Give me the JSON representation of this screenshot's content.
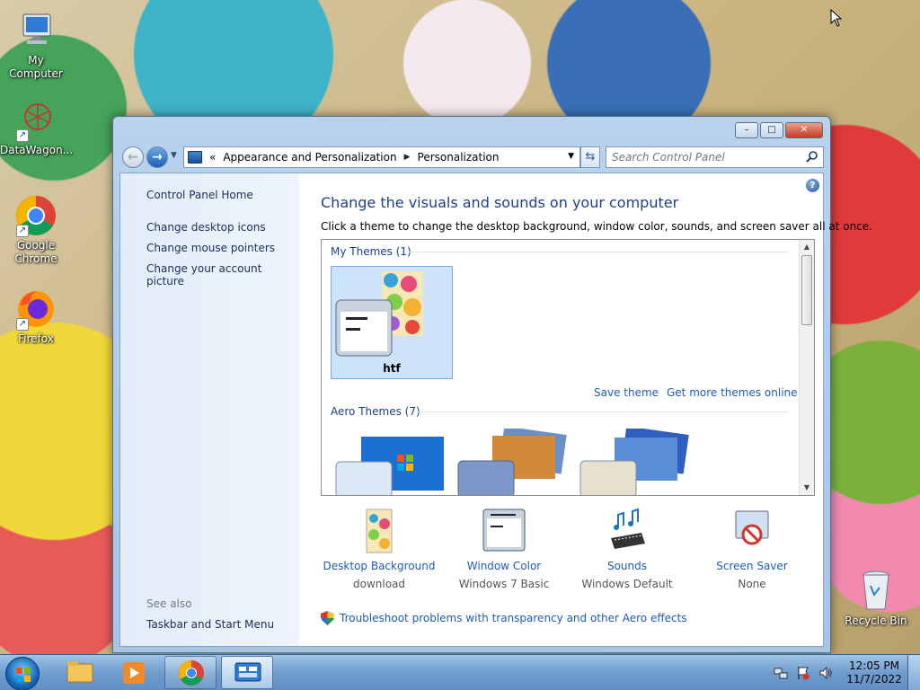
{
  "desktop": {
    "icons": [
      {
        "label": "My Computer"
      },
      {
        "label": "DataWagon..."
      },
      {
        "label": "Google Chrome"
      },
      {
        "label": "Firefox"
      },
      {
        "label": "Recycle Bin"
      }
    ]
  },
  "window": {
    "controls": {
      "minimize": "–",
      "maximize": "□",
      "close": "✕"
    },
    "address": {
      "overflow": "«",
      "segments": [
        "Appearance and Personalization",
        "Personalization"
      ]
    },
    "search": {
      "placeholder": "Search Control Panel"
    }
  },
  "left_pane": {
    "home": "Control Panel Home",
    "links": [
      "Change desktop icons",
      "Change mouse pointers",
      "Change your account picture"
    ],
    "see_also_label": "See also",
    "see_also_links": [
      "Taskbar and Start Menu"
    ]
  },
  "main": {
    "help": "?",
    "title": "Change the visuals and sounds on your computer",
    "subtitle": "Click a theme to change the desktop background, window color, sounds, and screen saver all at once.",
    "my_themes_header": "My Themes (1)",
    "selected_theme": "htf",
    "save_theme": "Save theme",
    "get_more": "Get more themes online",
    "aero_header": "Aero Themes (7)",
    "bottom": [
      {
        "title": "Desktop Background",
        "value": "download"
      },
      {
        "title": "Window Color",
        "value": "Windows 7 Basic"
      },
      {
        "title": "Sounds",
        "value": "Windows Default"
      },
      {
        "title": "Screen Saver",
        "value": "None"
      }
    ],
    "troubleshoot": "Troubleshoot problems with transparency and other Aero effects"
  },
  "taskbar": {
    "clock_time": "12:05 PM",
    "clock_date": "11/7/2022"
  },
  "colors": {
    "link": "#1e5bb8",
    "title": "#1e3f8a",
    "selection": "#cde3fb",
    "left_pane": "#e2edf9",
    "taskbar": "#6f9dcd"
  }
}
